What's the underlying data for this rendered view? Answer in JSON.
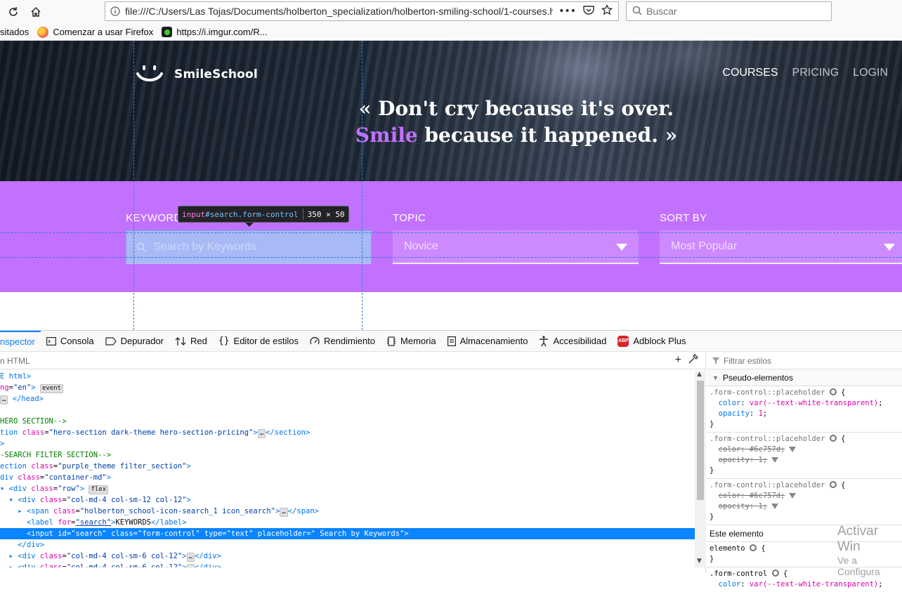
{
  "browser": {
    "url": "file:///C:/Users/Las Tojas/Documents/holberton_specialization/holberton-smiling-school/1-courses.ht",
    "search_placeholder": "Buscar",
    "bookmarks": [
      {
        "label": "sitados"
      },
      {
        "label": "Comenzar a usar Firefox"
      },
      {
        "label": "https://i.imgur.com/R..."
      }
    ]
  },
  "page": {
    "brand": "SmileSchool",
    "nav": [
      "COURSES",
      "PRICING",
      "LOGIN"
    ],
    "quote_line1": "« Don't cry because it's over.",
    "quote_smile": "Smile",
    "quote_line2_rest": " because it happened. »",
    "colors": {
      "accent": "#C271FF",
      "filter_bg": "#C271FF"
    },
    "filters": {
      "keyword_label": "KEYWORD",
      "keyword_placeholder": "Search by Keywords",
      "topic_label": "TOPIC",
      "topic_value": "Novice",
      "sort_label": "SORT BY",
      "sort_value": "Most Popular"
    },
    "tooltip": {
      "tag": "input",
      "idcls": "#search.form-control",
      "size": "350 × 50"
    }
  },
  "devtools": {
    "tabs": [
      "nspector",
      "Consola",
      "Depurador",
      "Red",
      "Editor de estilos",
      "Rendimiento",
      "Memoria",
      "Almacenamiento",
      "Accesibilidad",
      "Adblock Plus"
    ],
    "markup_search": "n HTML",
    "styles_filter": "Filtrar estilos",
    "pseudo_header": "Pseudo-elementos",
    "element_header": "Este elemento",
    "watermark": [
      "Activar Win",
      "Ve a Configura"
    ]
  }
}
